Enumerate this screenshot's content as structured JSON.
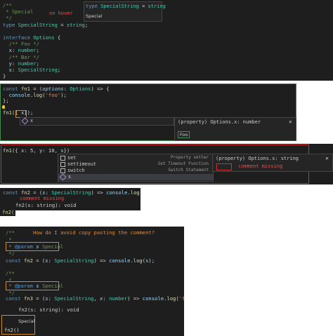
{
  "panel1": {
    "lines": [
      {
        "t": "/**",
        "c": "cm"
      },
      {
        "t": " * Special",
        "c": "cm"
      },
      {
        "t": " */",
        "c": "cm"
      },
      {
        "parts": [
          {
            "t": "type ",
            "c": "kw"
          },
          {
            "t": "SpecialString",
            "c": "ty"
          },
          {
            "t": " = ",
            "c": "pu"
          },
          {
            "t": "string",
            "c": "ty"
          },
          {
            "t": ";",
            "c": "pu"
          }
        ]
      },
      {
        "t": "",
        "c": "pu"
      },
      {
        "parts": [
          {
            "t": "interface ",
            "c": "kw"
          },
          {
            "t": "Options",
            "c": "ty"
          },
          {
            "t": " {",
            "c": "pu"
          }
        ]
      },
      {
        "t": "  /** Foo */",
        "c": "cm"
      },
      {
        "parts": [
          {
            "t": "  x",
            "c": "vr"
          },
          {
            "t": ": ",
            "c": "pu"
          },
          {
            "t": "number",
            "c": "ty"
          },
          {
            "t": ";",
            "c": "pu"
          }
        ]
      },
      {
        "t": "  /** Bar */",
        "c": "cm"
      },
      {
        "parts": [
          {
            "t": "  y",
            "c": "vr"
          },
          {
            "t": ": ",
            "c": "pu"
          },
          {
            "t": "number",
            "c": "ty"
          },
          {
            "t": ";",
            "c": "pu"
          }
        ]
      },
      {
        "parts": [
          {
            "t": "  s",
            "c": "vr"
          },
          {
            "t": ": ",
            "c": "pu"
          },
          {
            "t": "SpecialString",
            "c": "ty"
          },
          {
            "t": ";",
            "c": "pu"
          }
        ]
      },
      {
        "t": "}",
        "c": "pu"
      }
    ],
    "hover_title_parts": [
      {
        "t": "type ",
        "c": "kw"
      },
      {
        "t": "SpecialString",
        "c": "ty"
      },
      {
        "t": " = ",
        "c": "pu"
      },
      {
        "t": "string",
        "c": "ty"
      }
    ],
    "hover_doc": "Special",
    "annotation": "on hover"
  },
  "panel2": {
    "lines": [
      {
        "parts": [
          {
            "t": "const ",
            "c": "kw"
          },
          {
            "t": "fn1",
            "c": "fn"
          },
          {
            "t": " = (",
            "c": "pu"
          },
          {
            "t": "options",
            "c": "pm"
          },
          {
            "t": ": ",
            "c": "pu"
          },
          {
            "t": "Options",
            "c": "ty"
          },
          {
            "t": ") => {",
            "c": "pu"
          }
        ]
      },
      {
        "parts": [
          {
            "t": "  console",
            "c": "vr"
          },
          {
            "t": ".",
            "c": "pu"
          },
          {
            "t": "log",
            "c": "fn"
          },
          {
            "t": "(",
            "c": "pu"
          },
          {
            "t": "'foo'",
            "c": "st"
          },
          {
            "t": ");",
            "c": "pu"
          }
        ]
      },
      {
        "t": "};",
        "c": "pu"
      },
      {
        "t": "",
        "c": "pu"
      },
      {
        "parts": [
          {
            "t": "fn1",
            "c": "fn"
          },
          {
            "t": "({ x});",
            "c": "pu"
          }
        ]
      }
    ],
    "suggestion": "x",
    "hover_sig": "(property) Options.x: number",
    "hover_doc": "Foo",
    "close": "✕"
  },
  "panel3": {
    "line_parts": [
      {
        "t": "fn1",
        "c": "fn"
      },
      {
        "t": "({ ",
        "c": "pu"
      },
      {
        "t": "x",
        "c": "vr"
      },
      {
        "t": ": ",
        "c": "pu"
      },
      {
        "t": "5",
        "c": "pu"
      },
      {
        "t": ", ",
        "c": "pu"
      },
      {
        "t": "y",
        "c": "vr"
      },
      {
        "t": ": ",
        "c": "pu"
      },
      {
        "t": "10",
        "c": "pu"
      },
      {
        "t": ", ",
        "c": "pu"
      },
      {
        "t": "s",
        "c": "vr"
      },
      {
        "t": "})",
        "c": "pu"
      }
    ],
    "suggestions": [
      {
        "label": "set",
        "desc": "Property setter",
        "icon": "square"
      },
      {
        "label": "settimeout",
        "desc": "Set Timeout Function",
        "icon": "square"
      },
      {
        "label": "switch",
        "desc": "Switch Statement",
        "icon": "square"
      },
      {
        "label": "s",
        "desc": "",
        "icon": "cube"
      }
    ],
    "hover_sig": "(property) Options.s: string",
    "annotation": "comment missing",
    "close": "✕"
  },
  "panel4": {
    "line_parts": [
      {
        "t": "const ",
        "c": "kw"
      },
      {
        "t": "fn2",
        "c": "fn"
      },
      {
        "t": " = (",
        "c": "pu"
      },
      {
        "t": "s",
        "c": "pm"
      },
      {
        "t": ": ",
        "c": "pu"
      },
      {
        "t": "SpecialString",
        "c": "ty"
      },
      {
        "t": ") => ",
        "c": "pu"
      },
      {
        "t": "console",
        "c": "vr"
      },
      {
        "t": ".",
        "c": "pu"
      },
      {
        "t": "log",
        "c": "fn"
      },
      {
        "t": "(",
        "c": "pu"
      },
      {
        "t": "s",
        "c": "vr"
      },
      {
        "t": ");",
        "c": "pu"
      }
    ],
    "annotation": "comment missing",
    "sig_help": "fn2(s: string): void",
    "call_parts": [
      {
        "t": "fn2",
        "c": "fn"
      },
      {
        "t": "()",
        "c": "pu"
      }
    ]
  },
  "panel5": {
    "comment_open": "/**",
    "question": "How do I avoid copy pasting the comment?",
    "star": " *",
    "param1_parts": [
      {
        "t": " * ",
        "c": "cm"
      },
      {
        "t": "@param",
        "c": "kw"
      },
      {
        "t": " s ",
        "c": "pm"
      },
      {
        "t": "Special",
        "c": "cm"
      }
    ],
    "close_comment": " */",
    "fn2_parts": [
      {
        "t": "const ",
        "c": "kw"
      },
      {
        "t": "fn2",
        "c": "fn"
      },
      {
        "t": " = (",
        "c": "pu"
      },
      {
        "t": "s",
        "c": "pm"
      },
      {
        "t": ": ",
        "c": "pu"
      },
      {
        "t": "SpecialString",
        "c": "ty"
      },
      {
        "t": ") => ",
        "c": "pu"
      },
      {
        "t": "console",
        "c": "vr"
      },
      {
        "t": ".",
        "c": "pu"
      },
      {
        "t": "log",
        "c": "fn"
      },
      {
        "t": "(",
        "c": "pu"
      },
      {
        "t": "s",
        "c": "vr"
      },
      {
        "t": ");",
        "c": "pu"
      }
    ],
    "param2_parts": [
      {
        "t": " * ",
        "c": "cm"
      },
      {
        "t": "@param",
        "c": "kw"
      },
      {
        "t": " s ",
        "c": "pm"
      },
      {
        "t": "Special",
        "c": "cm"
      }
    ],
    "fn3_parts": [
      {
        "t": "const ",
        "c": "kw"
      },
      {
        "t": "fn3",
        "c": "fn"
      },
      {
        "t": " = (",
        "c": "pu"
      },
      {
        "t": "s",
        "c": "pm"
      },
      {
        "t": ": ",
        "c": "pu"
      },
      {
        "t": "SpecialString",
        "c": "ty"
      },
      {
        "t": ", ",
        "c": "pu"
      },
      {
        "t": "x",
        "c": "pm"
      },
      {
        "t": ": ",
        "c": "pu"
      },
      {
        "t": "number",
        "c": "ty"
      },
      {
        "t": ") => ",
        "c": "pu"
      },
      {
        "t": "console",
        "c": "vr"
      },
      {
        "t": ".",
        "c": "pu"
      },
      {
        "t": "log",
        "c": "fn"
      },
      {
        "t": "(",
        "c": "pu"
      },
      {
        "t": "'foo'",
        "c": "st"
      },
      {
        "t": ");",
        "c": "pu"
      }
    ],
    "sig_help": "fn2(s: string): void",
    "sig_doc": "Special",
    "call_parts": [
      {
        "t": "fn2",
        "c": "fn"
      },
      {
        "t": "()",
        "c": "pu"
      }
    ]
  }
}
